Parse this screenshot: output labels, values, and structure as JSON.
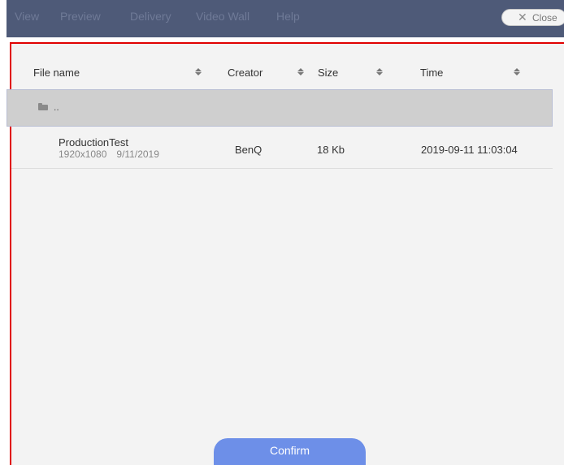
{
  "menu": {
    "items": [
      {
        "label": "View"
      },
      {
        "label": "Preview"
      },
      {
        "label": "Delivery"
      },
      {
        "label": "Video Wall"
      },
      {
        "label": "Help"
      }
    ],
    "close_label": "Close",
    "close_icon": "close-icon"
  },
  "table": {
    "columns": [
      {
        "label": "File name"
      },
      {
        "label": "Creator"
      },
      {
        "label": "Size"
      },
      {
        "label": "Time"
      }
    ],
    "parent_row": {
      "label": "..",
      "icon": "folder-icon"
    },
    "rows": [
      {
        "name": "ProductionTest",
        "resolution": "1920x1080",
        "date": "9/11/2019",
        "creator": "BenQ",
        "size": "18 Kb",
        "time": "2019-09-11 11:03:04"
      }
    ]
  },
  "actions": {
    "confirm_label": "Confirm"
  },
  "colors": {
    "topbar": "#4e5a78",
    "panel": "#f3f3f3",
    "highlight_border": "#e00000",
    "confirm": "#6d8fe8",
    "selected_row": "#cfcfcf"
  }
}
